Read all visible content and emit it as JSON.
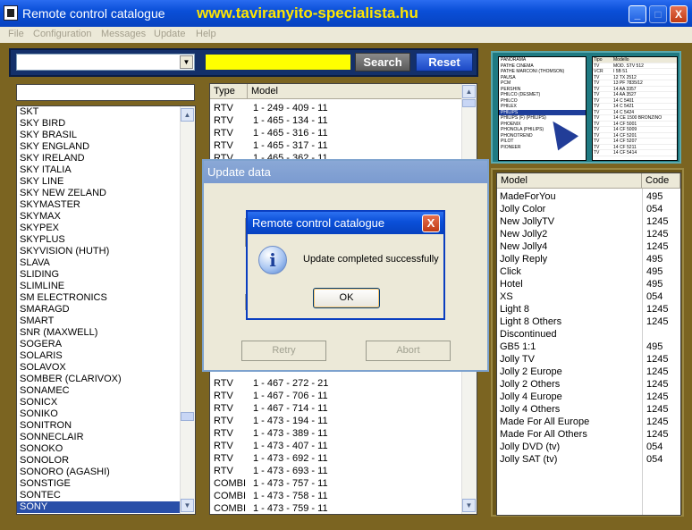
{
  "window": {
    "title": "Remote control catalogue",
    "url": "www.taviranyito-specialista.hu",
    "minimize": "_",
    "maximize": "□",
    "close": "X"
  },
  "menu": [
    "File",
    "Configuration",
    "Messages",
    "Update",
    "Help"
  ],
  "toolbar": {
    "combo_value": "",
    "search_value": "",
    "search_label": "Search",
    "reset_label": "Reset"
  },
  "preview": {
    "brands": [
      "PANORAMA",
      "PATHE CINEMA",
      "PATHE MARCONI (THOMSON)",
      "PAUSA",
      "PCM",
      "PERSHIN",
      "PHILCO (DESMET)",
      "PHILCO",
      "PHILEX",
      "PHILIPS",
      "PHILIPS (F) (PHILIPS)",
      "PHOENIX",
      "PHONOLA (PHILIPS)",
      "PHONOTREND",
      "PILOT",
      "PIONEER"
    ],
    "selected_brand": "PHILIPS",
    "table_header": [
      "Tipo",
      "Modello"
    ],
    "table_rows": [
      [
        "TV",
        "MOD. STV 512"
      ],
      [
        "VCR",
        "I 5B 51"
      ],
      [
        "TV",
        "12 TX 2512"
      ],
      [
        "TV",
        "13 PF 7835/12"
      ],
      [
        "TV",
        "14 AA 3357"
      ],
      [
        "TV",
        "14 AA 3527"
      ],
      [
        "TV",
        "14 C 5401"
      ],
      [
        "TV",
        "14 C 5421"
      ],
      [
        "TV",
        "14 C 5424"
      ],
      [
        "TV",
        "14 CE 1500 BRONZINO"
      ],
      [
        "TV",
        "14 CF 5001"
      ],
      [
        "TV",
        "14 CF 5009"
      ],
      [
        "TV",
        "14 CF 5201"
      ],
      [
        "TV",
        "14 CF 5207"
      ],
      [
        "TV",
        "14 CF 5211"
      ],
      [
        "TV",
        "14 CF 5414"
      ]
    ]
  },
  "brand_filter": "",
  "brands": [
    "SKT",
    "SKY BIRD",
    "SKY BRASIL",
    "SKY ENGLAND",
    "SKY IRELAND",
    "SKY ITALIA",
    "SKY LINE",
    "SKY NEW ZELAND",
    "SKYMASTER",
    "SKYMAX",
    "SKYPEX",
    "SKYPLUS",
    "SKYVISION (HUTH)",
    "SLAVA",
    "SLIDING",
    "SLIMLINE",
    "SM ELECTRONICS",
    "SMARAGD",
    "SMART",
    "SNR (MAXWELL)",
    "SOGERA",
    "SOLARIS",
    "SOLAVOX",
    "SOMBER (CLARIVOX)",
    "SONAMEC",
    "SONICX",
    "SONIKO",
    "SONITRON",
    "SONNECLAIR",
    "SONOKO",
    "SONOLOR",
    "SONORO (AGASHI)",
    "SONSTIGE",
    "SONTEC",
    "SONY"
  ],
  "selected_brand": "SONY",
  "type_model": {
    "headers": [
      "Type",
      "Model"
    ],
    "top_rows": [
      [
        "RTV",
        "1 - 249 - 409 - 11"
      ],
      [
        "RTV",
        "1 - 465 - 134 - 11"
      ],
      [
        "RTV",
        "1 - 465 - 316 - 11"
      ],
      [
        "RTV",
        "1 - 465 - 317 - 11"
      ],
      [
        "RTV",
        "1 - 465 - 362 - 11"
      ]
    ],
    "bottom_rows": [
      [
        "RTV",
        "1 - 467 - 272 - 21"
      ],
      [
        "RTV",
        "1 - 467 - 706 - 11"
      ],
      [
        "RTV",
        "1 - 467 - 714 - 11"
      ],
      [
        "RTV",
        "1 - 473 - 194 - 11"
      ],
      [
        "RTV",
        "1 - 473 - 389 - 11"
      ],
      [
        "RTV",
        "1 - 473 - 407 - 11"
      ],
      [
        "RTV",
        "1 - 473 - 692 - 11"
      ],
      [
        "RTV",
        "1 - 473 - 693 - 11"
      ],
      [
        "COMBI",
        "1 - 473 - 757 - 11"
      ],
      [
        "COMBI",
        "1 - 473 - 758 - 11"
      ],
      [
        "COMBI",
        "1 - 473 - 759 - 11"
      ]
    ]
  },
  "model_code": {
    "headers": [
      "Model",
      "Code"
    ],
    "rows": [
      [
        "MadeForYou",
        "495"
      ],
      [
        "Jolly Color",
        "054"
      ],
      [
        "New JollyTV",
        "1245"
      ],
      [
        "New Jolly2",
        "1245"
      ],
      [
        "New Jolly4",
        "1245"
      ],
      [
        "Jolly Reply",
        "495"
      ],
      [
        "Click",
        "495"
      ],
      [
        "Hotel",
        "495"
      ],
      [
        "XS",
        "054"
      ],
      [
        "Light 8",
        "1245"
      ],
      [
        "Light 8 Others",
        "1245"
      ],
      [
        "Discontinued",
        ""
      ],
      [
        "GB5 1:1",
        "495"
      ],
      [
        "Jolly TV",
        "1245"
      ],
      [
        "Jolly 2 Europe",
        "1245"
      ],
      [
        "Jolly 2 Others",
        "1245"
      ],
      [
        "Jolly 4 Europe",
        "1245"
      ],
      [
        "Jolly 4 Others",
        "1245"
      ],
      [
        "Made For All Europe",
        "1245"
      ],
      [
        "Made For All Others",
        "1245"
      ],
      [
        "Jolly DVD (tv)",
        "054"
      ],
      [
        "Jolly SAT (tv)",
        "054"
      ]
    ]
  },
  "update_dialog": {
    "title": "Update data",
    "retry_label": "Retry",
    "abort_label": "Abort"
  },
  "message_box": {
    "title": "Remote control catalogue",
    "icon": "info-icon",
    "icon_glyph": "i",
    "text": "Update completed successfully",
    "ok_label": "OK",
    "close": "X"
  },
  "colors": {
    "panel_bg": "#7b6421",
    "title_url": "#ffe600",
    "search_field": "#ffff00",
    "reset_button": "#1b48c5",
    "selection": "#2a4fa8"
  }
}
